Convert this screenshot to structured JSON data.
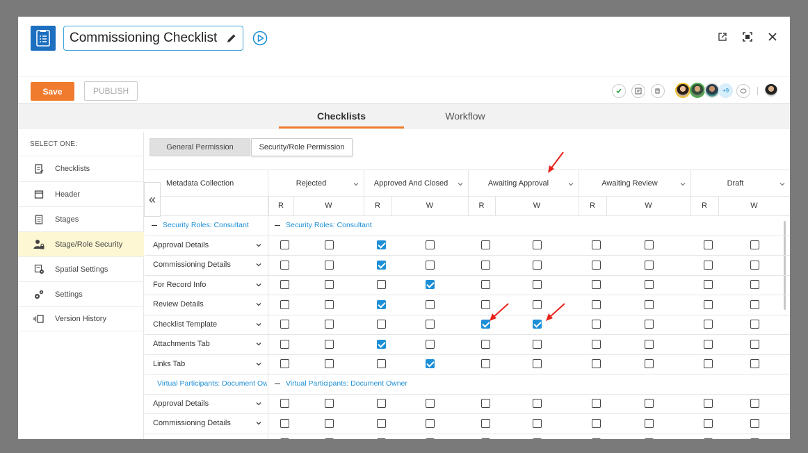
{
  "window": {
    "title": "Commissioning Checklist"
  },
  "toolbar": {
    "save_label": "Save",
    "publish_label": "PUBLISH",
    "more_users": "+9"
  },
  "tabs": [
    {
      "label": "Checklists",
      "active": true
    },
    {
      "label": "Workflow",
      "active": false
    }
  ],
  "sidebar": {
    "header": "SELECT ONE:",
    "items": [
      {
        "label": "Checklists",
        "icon": "checklist-icon",
        "active": false
      },
      {
        "label": "Header",
        "icon": "header-icon",
        "active": false
      },
      {
        "label": "Stages",
        "icon": "stages-icon",
        "active": false
      },
      {
        "label": "Stage/Role Security",
        "icon": "role-security-icon",
        "active": true
      },
      {
        "label": "Spatial Settings",
        "icon": "spatial-settings-icon",
        "active": false
      },
      {
        "label": "Settings",
        "icon": "gears-icon",
        "active": false
      },
      {
        "label": "Version History",
        "icon": "version-history-icon",
        "active": false
      }
    ]
  },
  "subtabs": {
    "general": "General Permission",
    "security": "Security/Role Permission"
  },
  "grid": {
    "first_col_header": "Metadata Collection",
    "read_label": "R",
    "write_label": "W",
    "stages": [
      "Rejected",
      "Approved And Closed",
      "Awaiting Approval",
      "Awaiting Review",
      "Draft"
    ],
    "sections": [
      {
        "label": "Security Roles: Consultant",
        "left_label": "Security Roles: Consultant",
        "rows": [
          {
            "label": "Approval Details",
            "checks": [
              false,
              false,
              true,
              false,
              false,
              false,
              false,
              false,
              false,
              false
            ]
          },
          {
            "label": "Commissioning Details",
            "checks": [
              false,
              false,
              true,
              false,
              false,
              false,
              false,
              false,
              false,
              false
            ]
          },
          {
            "label": "For Record Info",
            "checks": [
              false,
              false,
              false,
              true,
              false,
              false,
              false,
              false,
              false,
              false
            ]
          },
          {
            "label": "Review Details",
            "checks": [
              false,
              false,
              true,
              false,
              false,
              false,
              false,
              false,
              false,
              false
            ]
          },
          {
            "label": "Checklist Template",
            "checks": [
              false,
              false,
              false,
              false,
              true,
              true,
              false,
              false,
              false,
              false
            ]
          },
          {
            "label": "Attachments Tab",
            "checks": [
              false,
              false,
              true,
              false,
              false,
              false,
              false,
              false,
              false,
              false
            ]
          },
          {
            "label": "Links Tab",
            "checks": [
              false,
              false,
              false,
              true,
              false,
              false,
              false,
              false,
              false,
              false
            ]
          }
        ]
      },
      {
        "label": "Virtual Participants: Document Owner",
        "left_label": "Virtual Participants: Document Owner",
        "rows": [
          {
            "label": "Approval Details",
            "checks": [
              false,
              false,
              false,
              false,
              false,
              false,
              false,
              false,
              false,
              false
            ]
          },
          {
            "label": "Commissioning Details",
            "checks": [
              false,
              false,
              false,
              false,
              false,
              false,
              false,
              false,
              false,
              false
            ]
          },
          {
            "label": "",
            "checks": [
              false,
              false,
              false,
              false,
              false,
              false,
              false,
              false,
              false,
              false
            ]
          }
        ]
      }
    ]
  },
  "colors": {
    "accent": "#f07a2e",
    "primary": "#1d8fd6",
    "annotation": "#e8231a"
  }
}
